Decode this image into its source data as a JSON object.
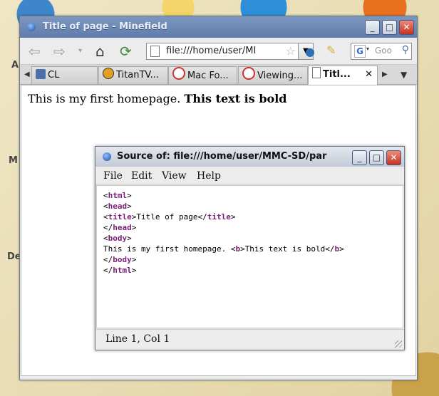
{
  "desktop": {
    "labels": [
      "A",
      "M",
      "De"
    ]
  },
  "browser": {
    "title": "Title of page - Minefield",
    "url": "file:///home/user/MI",
    "search_placeholder": "Goo",
    "tabs": [
      {
        "label": "CL",
        "icon": "page-favicon-icon"
      },
      {
        "label": "TitanTV...",
        "icon": "titantv-icon"
      },
      {
        "label": "Mac Fo...",
        "icon": "macforum-icon"
      },
      {
        "label": "Viewing...",
        "icon": "macforum-icon"
      },
      {
        "label": "Titl...",
        "icon": "page-icon",
        "active": true
      }
    ],
    "content": {
      "plain_text": "This is my first homepage.",
      "bold_text": "This text is bold"
    }
  },
  "source_window": {
    "title": "Source of: file:///home/user/MMC-SD/par",
    "menu": [
      "File",
      "Edit",
      "View",
      "Help"
    ],
    "lines": [
      "<html>",
      "<head>",
      "<title>Title of page</title>",
      "</head>",
      "<body>",
      "This is my first homepage. <b>This text is bold</b>",
      "</body>",
      "</html>"
    ],
    "status": "Line 1, Col 1"
  },
  "colors": {
    "titlebar_active": "#5e7cac",
    "tag": "#7a1e7a",
    "close": "#c5321e"
  }
}
